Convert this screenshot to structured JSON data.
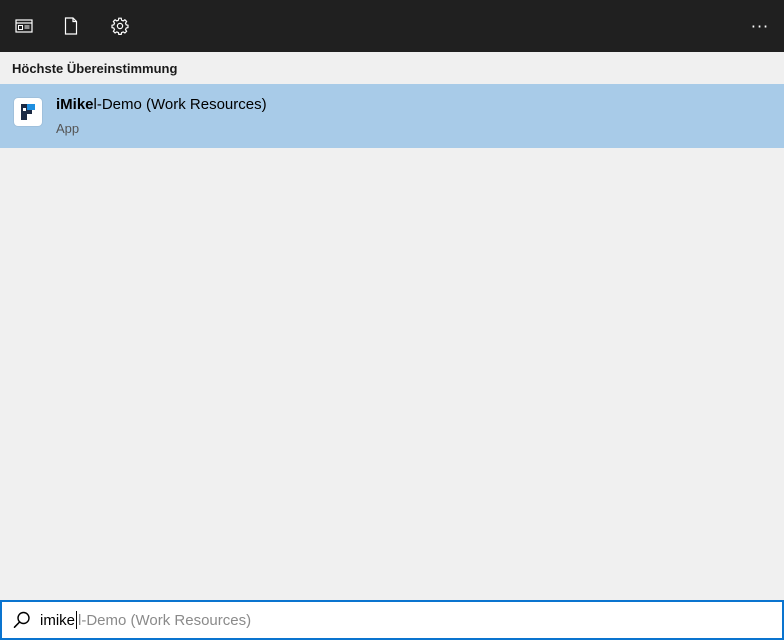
{
  "toolbar": {
    "buttons": [
      {
        "name": "apps-filter",
        "icon": "window-icon"
      },
      {
        "name": "documents-filter",
        "icon": "document-icon"
      },
      {
        "name": "settings-filter",
        "icon": "gear-icon"
      }
    ],
    "more_icon": "ellipsis-icon",
    "more_label": "···"
  },
  "section": {
    "title": "Höchste Übereinstimmung"
  },
  "best_match": {
    "title_match": "iMike",
    "title_rest": "l-Demo (Work Resources)",
    "type": "App",
    "icon": "app-icon",
    "highlight_color": "#a8cbe8"
  },
  "search": {
    "query": "imike",
    "autocomplete": "l-Demo (Work Resources)",
    "icon": "search-icon",
    "border_color": "#0a74cf"
  },
  "colors": {
    "topbar": "#202020",
    "background": "#f0f0f0"
  }
}
